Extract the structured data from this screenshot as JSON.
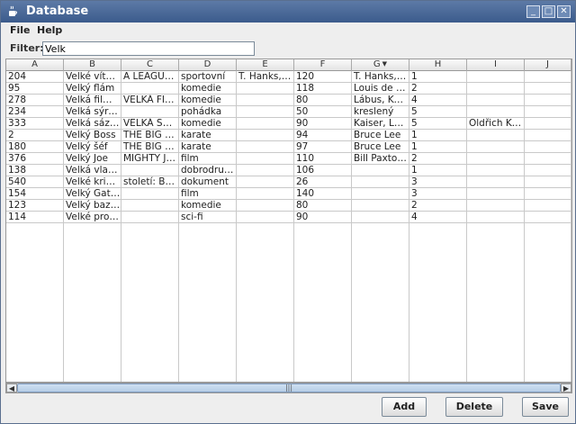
{
  "window": {
    "title": "Database",
    "app_icon": "java-cup-icon",
    "controls": [
      "minimize-icon",
      "maximize-icon",
      "close-icon"
    ]
  },
  "menu": [
    "File",
    "Help"
  ],
  "filter": {
    "label": "Filter:",
    "value": "Velk"
  },
  "table": {
    "columns": [
      "A",
      "B",
      "C",
      "D",
      "E",
      "F",
      "G",
      "H",
      "I",
      "J"
    ],
    "sorted_column": "G",
    "rows": [
      [
        "204",
        "Velké vítě…",
        "A LEAGUE…",
        "sportovní",
        "T. Hanks, …",
        "120",
        "T. Hanks, …",
        "1",
        "",
        ""
      ],
      [
        "95",
        "Velký flám",
        "",
        "komedie",
        "",
        "118",
        "Louis de F…",
        "2",
        "",
        ""
      ],
      [
        "278",
        "Velká film…",
        "VELKÁ FIL…",
        "komedie",
        "",
        "80",
        "Lábus, Kai…",
        "4",
        "",
        ""
      ],
      [
        "234",
        "Velká sýro…",
        "",
        "pohádka",
        "",
        "50",
        "kreslený",
        "5",
        "",
        ""
      ],
      [
        "333",
        "Velká sáz…",
        "VELKÁ SÁ…",
        "komedie",
        "",
        "90",
        "Kaiser, Lá…",
        "5",
        "Oldřich Ka…",
        ""
      ],
      [
        "2",
        "Velký Boss",
        "THE BIG B…",
        "karate",
        "",
        "94",
        "Bruce Lee",
        "1",
        "",
        ""
      ],
      [
        "180",
        "Velký šéf",
        "THE BIG B…",
        "karate",
        "",
        "97",
        "Bruce Lee",
        "1",
        "",
        ""
      ],
      [
        "376",
        "Velký Joe",
        "MIGHTY J…",
        "film",
        "",
        "110",
        "Bill Paxton…",
        "2",
        "",
        ""
      ],
      [
        "138",
        "Velká vlak…",
        "",
        "dobrodru…",
        "",
        "106",
        "",
        "1",
        "",
        ""
      ],
      [
        "540",
        "Velké kri…",
        "století: Bo…",
        "dokument",
        "",
        "26",
        "",
        "3",
        "",
        ""
      ],
      [
        "154",
        "Velký Gat…",
        "",
        "film",
        "",
        "140",
        "",
        "3",
        "",
        ""
      ],
      [
        "123",
        "Velký baz…",
        "",
        "komedie",
        "",
        "80",
        "",
        "2",
        "",
        ""
      ],
      [
        "114",
        "Velké pro…",
        "",
        "sci-fi",
        "",
        "90",
        "",
        "4",
        "",
        ""
      ]
    ]
  },
  "buttons": {
    "add": "Add",
    "delete": "Delete",
    "save": "Save"
  }
}
